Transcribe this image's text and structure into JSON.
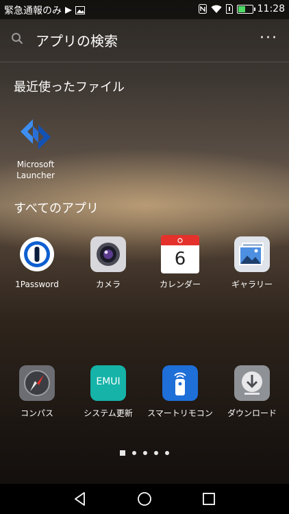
{
  "status_bar": {
    "left_text": "緊急通報のみ",
    "time": "11:28"
  },
  "search": {
    "placeholder": "アプリの検索",
    "overflow_label": "···"
  },
  "recent": {
    "title": "最近使ったファイル",
    "items": [
      {
        "label": "Microsoft Launcher",
        "icon": "microsoft-launcher-icon"
      }
    ]
  },
  "all_apps": {
    "title": "すべてのアプリ",
    "apps": [
      {
        "label": "1Password",
        "icon": "1password-icon"
      },
      {
        "label": "カメラ",
        "icon": "camera-icon"
      },
      {
        "label": "カレンダー",
        "icon": "calendar-icon",
        "calendar_day": "6"
      },
      {
        "label": "ギャラリー",
        "icon": "gallery-icon"
      },
      {
        "label": "コンパス",
        "icon": "compass-icon"
      },
      {
        "label": "システム更新",
        "icon": "emui-update-icon",
        "emui_text": "EMUI"
      },
      {
        "label": "スマートリモコン",
        "icon": "smart-remote-icon"
      },
      {
        "label": "ダウンロード",
        "icon": "download-icon"
      }
    ]
  },
  "pager": {
    "pages": 5,
    "current": 1
  },
  "colors": {
    "accent_blue": "#1e6fd8",
    "emui_teal": "#15b3a8",
    "calendar_red": "#e5312b",
    "battery_green": "#4cd964"
  }
}
